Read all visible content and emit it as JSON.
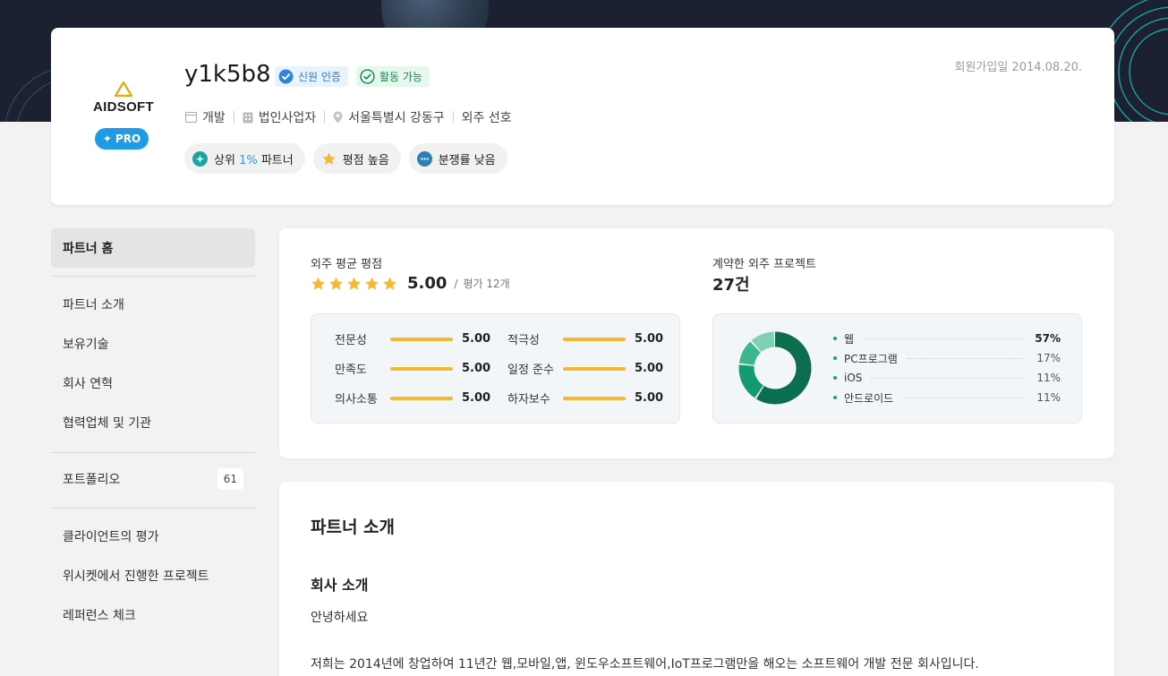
{
  "header": {
    "name": "y1k5b8",
    "logo_text": "AIDSOFT",
    "pro_label": "PRO",
    "verified_label": "신원 인증",
    "available_label": "활동 가능",
    "joined": "회원가입일 2014.08.20.",
    "meta": [
      {
        "icon": "folder-icon",
        "text": "개발"
      },
      {
        "icon": "building-icon",
        "text": "법인사업자"
      },
      {
        "icon": "location-pin-icon",
        "text": "서울특별시 강동구"
      },
      {
        "icon": "",
        "text": "외주 선호"
      }
    ],
    "chips": {
      "top": {
        "prefix": "상위 ",
        "highlight": "1%",
        "suffix": " 파트너"
      },
      "rating": "평점 높음",
      "dispute": "분쟁률 낮음"
    }
  },
  "sidebar": {
    "home": "파트너 홈",
    "items1": [
      "파트너 소개",
      "보유기술",
      "회사 연혁",
      "협력업체 및 기관"
    ],
    "portfolio": {
      "label": "포트폴리오",
      "count": "61"
    },
    "items2": [
      "클라이언트의 평가",
      "위시켓에서 진행한 프로젝트",
      "레퍼런스 체크"
    ]
  },
  "stats": {
    "avg_label": "외주 평균 평점",
    "avg_score": "5.00",
    "slash": "/",
    "review_count": "평가 12개",
    "contract_label": "계약한 외주 프로젝트",
    "contract_count": "27건",
    "ratings": [
      {
        "name": "전문성",
        "value": "5.00"
      },
      {
        "name": "적극성",
        "value": "5.00"
      },
      {
        "name": "만족도",
        "value": "5.00"
      },
      {
        "name": "일정 준수",
        "value": "5.00"
      },
      {
        "name": "의사소통",
        "value": "5.00"
      },
      {
        "name": "하자보수",
        "value": "5.00"
      }
    ]
  },
  "chart_data": {
    "type": "pie",
    "categories": [
      "웹",
      "PC프로그램",
      "iOS",
      "안드로이드"
    ],
    "values": [
      57,
      17,
      11,
      11
    ],
    "labels": [
      "57%",
      "17%",
      "11%",
      "11%"
    ],
    "colors": [
      "#0b6e4f",
      "#139a6e",
      "#3cb78d",
      "#7fd1b2"
    ]
  },
  "intro": {
    "title": "파트너 소개",
    "subtitle": "회사 소개",
    "p1": "안녕하세요",
    "p2": "저희는 2014년에 창업하여 11년간 웹,모바일,앱, 윈도우소프트웨어,IoT프로그램만을 해오는 소프트웨어 개발 전문 회사입니다."
  },
  "colors": {
    "accent": "#1e9be6",
    "star": "#f6b733",
    "hero_bg": "#1b2130"
  }
}
